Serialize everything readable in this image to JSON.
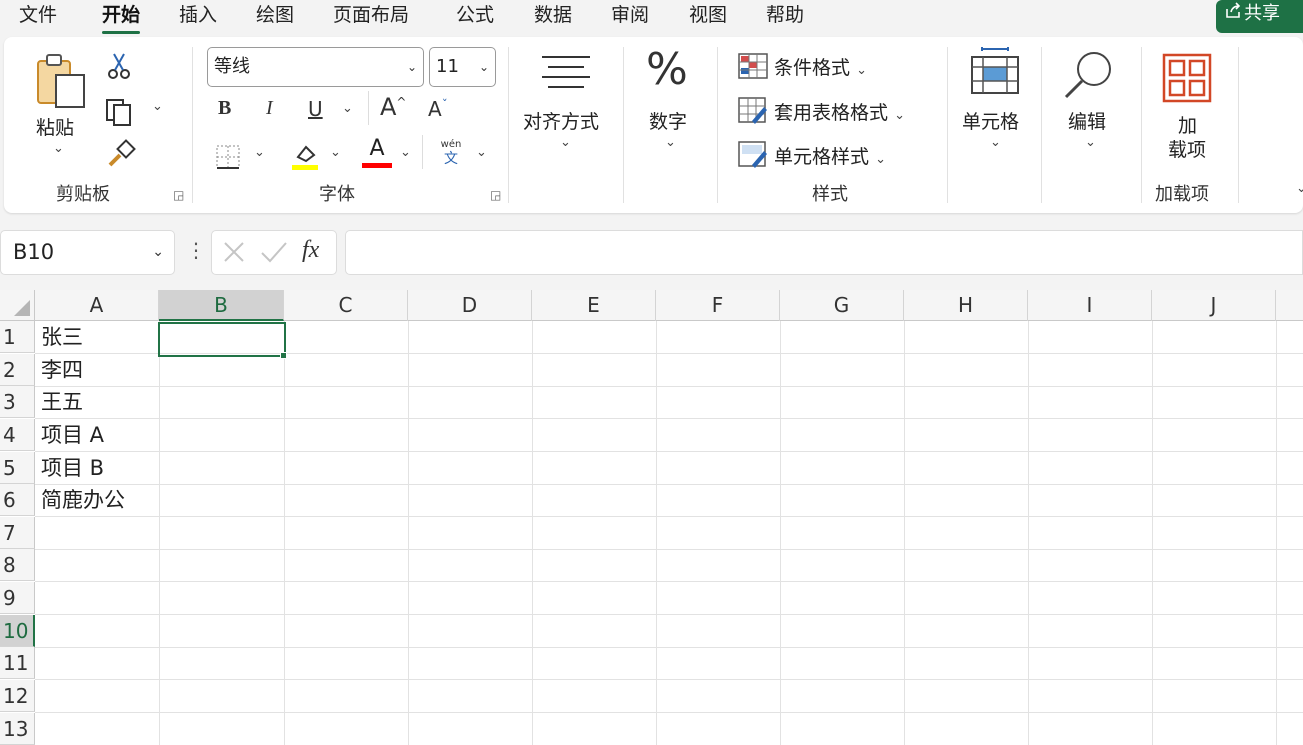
{
  "menu": {
    "tabs": [
      "文件",
      "开始",
      "插入",
      "绘图",
      "页面布局",
      "公式",
      "数据",
      "审阅",
      "视图",
      "帮助"
    ],
    "active": "开始",
    "share_label": "共享"
  },
  "ribbon": {
    "clipboard": {
      "paste_label": "粘贴",
      "group_label": "剪贴板"
    },
    "font": {
      "font_name": "等线",
      "font_size": "11",
      "group_label": "字体",
      "bold": "B",
      "italic": "I",
      "underline": "U",
      "grow": "A",
      "shrink": "A",
      "phonetic_top": "wén",
      "phonetic_bottom": "文",
      "font_color_glyph": "A"
    },
    "alignment": {
      "label": "对齐方式"
    },
    "number": {
      "label": "数字",
      "glyph": "%"
    },
    "styles": {
      "conditional": "条件格式",
      "table": "套用表格格式",
      "cell_styles": "单元格样式",
      "group_label": "样式"
    },
    "cells": {
      "label": "单元格"
    },
    "editing": {
      "label": "编辑"
    },
    "addins": {
      "label_line1": "加",
      "label_line2": "载项",
      "group_label": "加载项"
    }
  },
  "formula_bar": {
    "name_box": "B10",
    "fx": "fx",
    "formula": ""
  },
  "sheet": {
    "columns": [
      "A",
      "B",
      "C",
      "D",
      "E",
      "F",
      "G",
      "H",
      "I",
      "J"
    ],
    "selected_column": "B",
    "rows": [
      "1",
      "2",
      "3",
      "4",
      "5",
      "6",
      "7",
      "8",
      "9",
      "10",
      "11",
      "12",
      "13"
    ],
    "selected_row": "10",
    "cells_A": [
      "张三",
      "李四",
      "王五",
      "项目 A",
      "项目 B",
      "简鹿办公"
    ],
    "active_cell": "B10"
  },
  "colors": {
    "accent": "#217346",
    "fill_yellow": "#ffff00",
    "font_red": "#ff0000"
  }
}
